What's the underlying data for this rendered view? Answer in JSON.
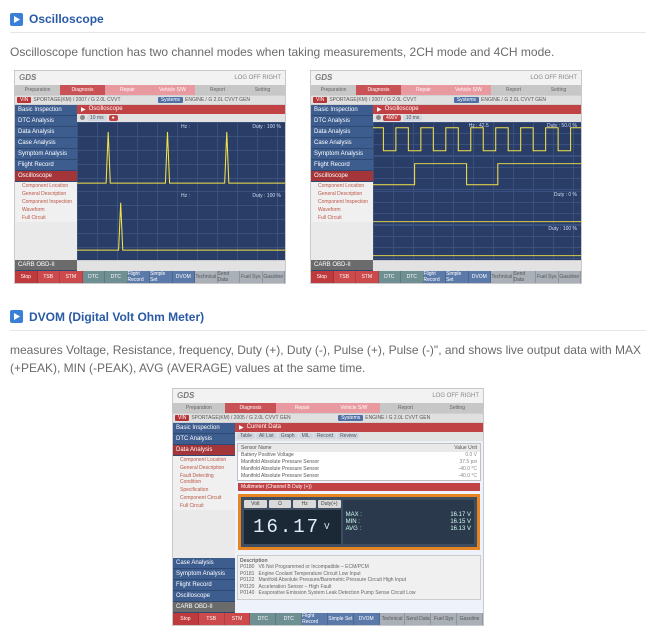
{
  "sections": {
    "osc": {
      "title": "Oscilloscope",
      "body": "Oscilloscope function has two channel modes when taking measurements, 2CH mode and 4CH mode."
    },
    "dvom": {
      "title": "DVOM (Digital Volt Ohm Meter)",
      "body": "measures Voltage, Resistance, frequency, Duty (+), Duty (-), Pulse (+), Pulse (-)\", and shows live output data with MAX (+PEAK), MIN (-PEAK), AVG (AVERAGE) values at the same time."
    }
  },
  "app": {
    "logo_a": "G",
    "logo_b": "DS",
    "status": "LOG OFF  RIGHT",
    "topnav": [
      "Preparation",
      "Diagnosis",
      "Repair",
      "Vehicle S/W",
      "Report",
      "Setting"
    ],
    "vin_label": "VIN",
    "vin1": "SPORTAGE(KM) / 2007 / G 2.0L CVVT",
    "vin2": "SPORTAGE(KM) / 2005 / G 2.0L CVVT GEN",
    "sys_label": "Systems",
    "sys_val": "ENGINE / G 2.0L CVVT GEN",
    "sidebar_common": [
      "Basic Inspection",
      "DTC Analysis",
      "Data Analysis",
      "Case Analysis",
      "Symptom Analysis",
      "Flight Record"
    ],
    "sidebar_osc_sel": "Oscilloscope",
    "sidebar_dvom_sel": "Data Analysis",
    "side_sub": [
      "Component Location",
      "General Description",
      "Component Inspection",
      "Fault Detecting Condition",
      "Specification",
      "Component Circuit",
      "Full Circuit"
    ],
    "side_sub_osc": [
      "Component Location",
      "General Description",
      "Component Inspection",
      "Waveform",
      "Full Circuit"
    ],
    "obd": "CARB OBD-II",
    "osc_hdr": "Oscilloscope",
    "osc_hdr_icon": "▶",
    "osc_ctrl": {
      "ms": "10 ms"
    },
    "scope_labels": {
      "hz1": "Hz : ",
      "duty1": "Duty : 100 %",
      "duty2": "Duty : 0 %",
      "hz_val": "Hz : 42.5",
      "duty50": "Duty : 50.0 %"
    },
    "dvom_hdr": "Current Data",
    "dvom_tabs": [
      "Table",
      "All List",
      "Graph",
      "MIL",
      "Record",
      "Review"
    ],
    "dvom_th": {
      "name": "Sensor Name",
      "val": "Value  Unit"
    },
    "dvom_rows": [
      {
        "n": "Battery Positive Voltage",
        "v": "0.0  V"
      },
      {
        "n": "Manifold Absolute Pressure Sensor",
        "v": "37.5  psi"
      },
      {
        "n": "Manifold Absolute Pressure Sensor",
        "v": "-40.0  °C"
      },
      {
        "n": "Manifold Absolute Pressure Sensor",
        "v": "-40.0  °C"
      }
    ],
    "dvom_strip": "Multimeter (Channel B  Duty (+))",
    "dvom_btns": [
      "Volt",
      "Ω",
      "Hz",
      "Duty(+)"
    ],
    "dvom_reading": "16.17",
    "dvom_unit": "V",
    "dvom_side": [
      {
        "l": "MAX :",
        "v": "16.17  V"
      },
      {
        "l": "MIN :",
        "v": "16.15  V"
      },
      {
        "l": "AVG :",
        "v": "16.13  V"
      }
    ],
    "dvom_desc_h": "Description",
    "dvom_desc_codes": [
      "P0180",
      "P0181",
      "P0122",
      "P0120",
      "P0140"
    ],
    "dvom_desc_lines": [
      "V6 Not Programmed or Incompatible – ECM/PCM",
      "Engine Coolant Temperature Circuit Low Input",
      "Manifold Absolute Pressure/Barometric Pressure Circuit High Input",
      "Acceleration Sensor – High Fault",
      "Evaporative Emission System Leak Detection Pump Sense Circuit Low"
    ],
    "footer": [
      "Stop",
      "TSB",
      "STM",
      "DTC",
      "DTC",
      "Flight Record",
      "Simple Set",
      "DVOM",
      "Technical",
      "Send Data",
      "Fuel Sys",
      "Gasoline"
    ]
  }
}
